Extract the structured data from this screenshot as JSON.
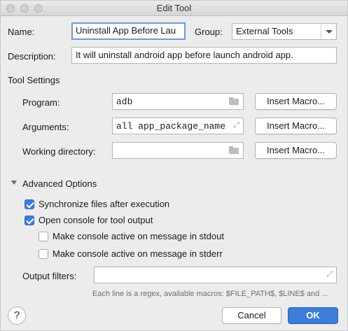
{
  "window": {
    "title": "Edit Tool"
  },
  "name": {
    "label": "Name:",
    "value": "Uninstall App Before Lau"
  },
  "group": {
    "label": "Group:",
    "value": "External Tools"
  },
  "description": {
    "label": "Description:",
    "value": "It will uninstall android app before launch android app."
  },
  "tool_settings": {
    "heading": "Tool Settings",
    "program": {
      "label": "Program:",
      "value": "adb",
      "button": "Insert Macro..."
    },
    "arguments": {
      "label": "Arguments:",
      "value": "all app_package_name",
      "button": "Insert Macro..."
    },
    "working_directory": {
      "label": "Working directory:",
      "value": "",
      "button": "Insert Macro..."
    }
  },
  "advanced": {
    "heading": "Advanced Options",
    "options": [
      {
        "label": "Synchronize files after execution",
        "checked": true
      },
      {
        "label": "Open console for tool output",
        "checked": true
      },
      {
        "label": "Make console active on message in stdout",
        "checked": false
      },
      {
        "label": "Make console active on message in stderr",
        "checked": false
      }
    ],
    "output_filters": {
      "label": "Output filters:",
      "value": ""
    },
    "hint": "Each line is a regex, available macros: $FILE_PATH$, $LINE$ and ..."
  },
  "footer": {
    "help": "?",
    "cancel": "Cancel",
    "ok": "OK"
  },
  "colors": {
    "accent": "#3d7cd8",
    "focus_ring": "#6e9ad9"
  }
}
